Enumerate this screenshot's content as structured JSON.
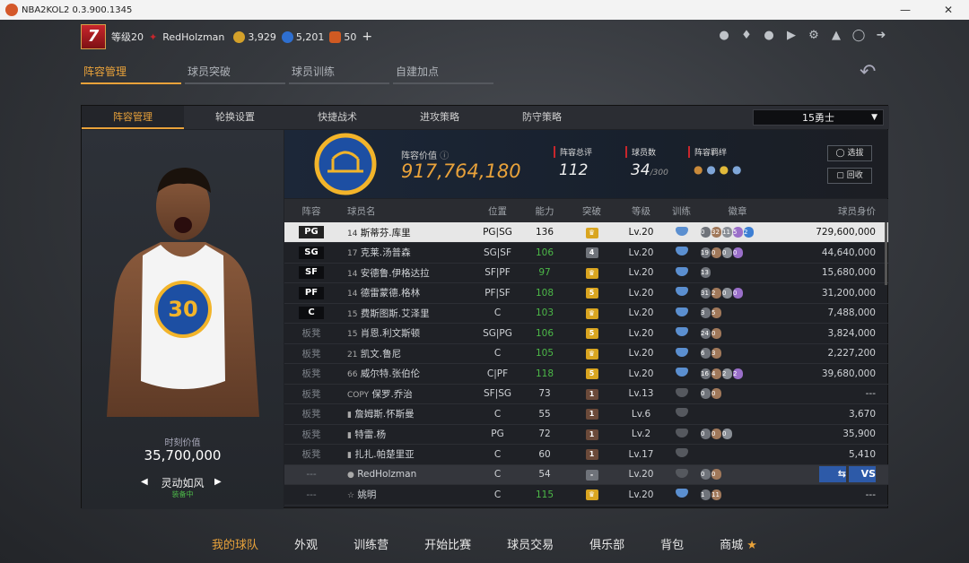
{
  "window": {
    "title": "NBA2KOL2 0.3.900.1345"
  },
  "user": {
    "level": "7",
    "level_label": "等级20",
    "name": "RedHolzman",
    "coins": "3,929",
    "points": "5,201",
    "tickets": "50",
    "plus": "+"
  },
  "main_tabs": [
    "阵容管理",
    "球员突破",
    "球员训练",
    "自建加点"
  ],
  "sub_tabs": [
    "阵容管理",
    "轮换设置",
    "快捷战术",
    "进攻策略",
    "防守策略"
  ],
  "team_select": "15勇士",
  "hero": {
    "number": "30",
    "value_label": "时刻价值",
    "value": "35,700,000",
    "style": "灵动如风",
    "status": "装备中"
  },
  "summary": {
    "value_label": "阵容价值",
    "value": "917,764,180",
    "rating_label": "阵容总评",
    "rating": "112",
    "count_label": "球员数",
    "count": "34",
    "count_max": "/300",
    "bond_label": "阵容羁绊",
    "btn_select": "选拔",
    "btn_recycle": "回收"
  },
  "table": {
    "headers": [
      "阵容",
      "球员名",
      "位置",
      "能力",
      "突破",
      "等级",
      "训练",
      "徽章",
      "球员身价"
    ],
    "rows": [
      {
        "slot": "PG",
        "num": "14",
        "name": "斯蒂芬.库里",
        "pos": "PG|SG",
        "ability": "136",
        "bt": "crown",
        "lv": "Lv.20",
        "honors": [
          "0",
          "32",
          "11",
          "5",
          "2"
        ],
        "value": "729,600,000",
        "cls": "sel"
      },
      {
        "slot": "SG",
        "num": "17",
        "name": "克莱.汤普森",
        "pos": "SG|SF",
        "ability": "106",
        "bt": "4",
        "lv": "Lv.20",
        "honors": [
          "19",
          "0",
          "0",
          "0"
        ],
        "value": "44,640,000",
        "cls": ""
      },
      {
        "slot": "SF",
        "num": "14",
        "name": "安德鲁.伊格达拉",
        "pos": "SF|PF",
        "ability": "97",
        "bt": "crown",
        "lv": "Lv.20",
        "honors": [
          "13"
        ],
        "value": "15,680,000",
        "cls": ""
      },
      {
        "slot": "PF",
        "num": "14",
        "name": "德雷蒙德.格林",
        "pos": "PF|SF",
        "ability": "108",
        "bt": "5",
        "lv": "Lv.20",
        "honors": [
          "31",
          "2",
          "0",
          "0"
        ],
        "value": "31,200,000",
        "cls": ""
      },
      {
        "slot": "C",
        "num": "15",
        "name": "费斯图斯.艾泽里",
        "pos": "C",
        "ability": "103",
        "bt": "crown",
        "lv": "Lv.20",
        "honors": [
          "3",
          "5"
        ],
        "value": "7,488,000",
        "cls": ""
      },
      {
        "slot": "板凳",
        "num": "15",
        "name": "肖恩.利文斯顿",
        "pos": "SG|PG",
        "ability": "106",
        "bt": "5",
        "lv": "Lv.20",
        "honors": [
          "24",
          "0"
        ],
        "value": "3,824,000",
        "cls": "bench"
      },
      {
        "slot": "板凳",
        "num": "21",
        "name": "凯文.鲁尼",
        "pos": "C",
        "ability": "105",
        "bt": "crown",
        "lv": "Lv.20",
        "honors": [
          "6",
          "3"
        ],
        "value": "2,227,200",
        "cls": "bench"
      },
      {
        "slot": "板凳",
        "num": "66",
        "name": "威尔特.张伯伦",
        "pos": "C|PF",
        "ability": "118",
        "bt": "5",
        "lv": "Lv.20",
        "honors": [
          "16",
          "4",
          "2",
          "2"
        ],
        "value": "39,680,000",
        "cls": "bench"
      },
      {
        "slot": "板凳",
        "num": "COPY",
        "name": "保罗.乔治",
        "pos": "SF|SG",
        "ability": "73",
        "bt": "1",
        "lv": "Lv.13",
        "honors": [
          "0",
          "0"
        ],
        "value": "---",
        "cls": "bench"
      },
      {
        "slot": "板凳",
        "num": "",
        "name": "詹姆斯.怀斯曼",
        "pos": "C",
        "ability": "55",
        "bt": "1",
        "lv": "Lv.6",
        "honors": [],
        "value": "3,670",
        "cls": "bench"
      },
      {
        "slot": "板凳",
        "num": "",
        "name": "特雷.杨",
        "pos": "PG",
        "ability": "72",
        "bt": "1",
        "lv": "Lv.2",
        "honors": [
          "0",
          "0",
          "0"
        ],
        "value": "35,900",
        "cls": "bench"
      },
      {
        "slot": "板凳",
        "num": "",
        "name": "扎扎.帕楚里亚",
        "pos": "C",
        "ability": "60",
        "bt": "1",
        "lv": "Lv.17",
        "honors": [],
        "value": "5,410",
        "cls": "bench"
      },
      {
        "slot": "---",
        "num": "",
        "name": "RedHolzman",
        "pos": "C",
        "ability": "54",
        "bt": "dash",
        "lv": "Lv.20",
        "honors": [
          "0",
          "0"
        ],
        "value": "",
        "cls": "me"
      },
      {
        "slot": "---",
        "num": "",
        "name": "姚明",
        "pos": "C",
        "ability": "115",
        "bt": "crown",
        "lv": "Lv.20",
        "honors": [
          "1",
          "11"
        ],
        "value": "---",
        "cls": "bench"
      }
    ],
    "vs_label": "VS"
  },
  "bottom_nav": [
    "我的球队",
    "外观",
    "训练营",
    "开始比赛",
    "球员交易",
    "俱乐部",
    "背包",
    "商城"
  ]
}
